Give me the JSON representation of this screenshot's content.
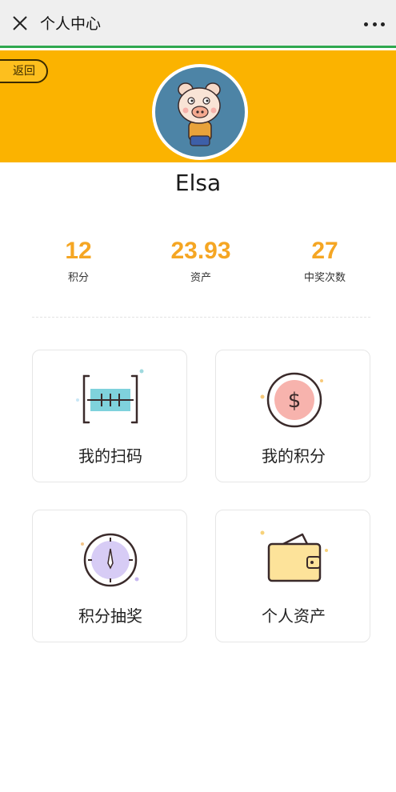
{
  "navbar": {
    "title": "个人中心"
  },
  "header": {
    "back_label": "返回"
  },
  "profile": {
    "username": "Elsa"
  },
  "stats": [
    {
      "value": "12",
      "label": "积分"
    },
    {
      "value": "23.93",
      "label": "资产"
    },
    {
      "value": "27",
      "label": "中奖次数"
    }
  ],
  "menu": [
    {
      "label": "我的扫码",
      "icon": "scan-code-icon"
    },
    {
      "label": "我的积分",
      "icon": "dollar-coin-icon"
    },
    {
      "label": "积分抽奖",
      "icon": "compass-icon"
    },
    {
      "label": "个人资产",
      "icon": "wallet-icon"
    }
  ],
  "colors": {
    "accent": "#f5a623",
    "header_bg": "#fbb300",
    "nav_line": "#2fa84f"
  }
}
